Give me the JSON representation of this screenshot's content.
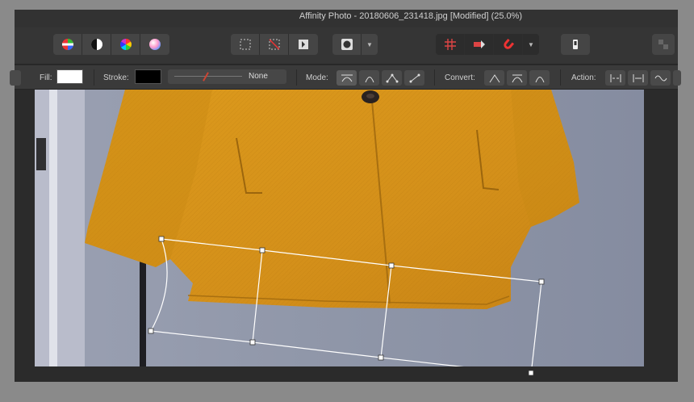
{
  "window": {
    "title": "Affinity Photo - 20180606_231418.jpg [Modified] (25.0%)"
  },
  "toolbar": {
    "groups": [
      {
        "name": "adjustments",
        "icons": [
          "color-wheel-icon",
          "contrast-icon",
          "hue-wheel-icon",
          "gradient-sphere-icon"
        ]
      },
      {
        "name": "selection",
        "icons": [
          "marquee-select-icon",
          "deselect-icon",
          "invert-selection-icon"
        ]
      },
      {
        "name": "quickmask",
        "icons": [
          "circle-mask-icon",
          "chevron-down-icon"
        ]
      },
      {
        "name": "snapping",
        "icons": [
          "grid-icon",
          "force-pixel-icon",
          "magnet-icon",
          "chevron-down-icon"
        ]
      },
      {
        "name": "assistant",
        "icons": [
          "assistant-icon"
        ]
      },
      {
        "name": "persona",
        "icons": [
          "persona-icon"
        ]
      }
    ]
  },
  "context": {
    "fill_label": "Fill:",
    "fill_color": "#ffffff",
    "stroke_label": "Stroke:",
    "stroke_color": "#000000",
    "stroke_value": "None",
    "mode_label": "Mode:",
    "convert_label": "Convert:",
    "action_label": "Action:"
  },
  "colors": {
    "coat": "#d9961a",
    "background": "#8e94a4",
    "door_frame": "#b9bccb"
  }
}
